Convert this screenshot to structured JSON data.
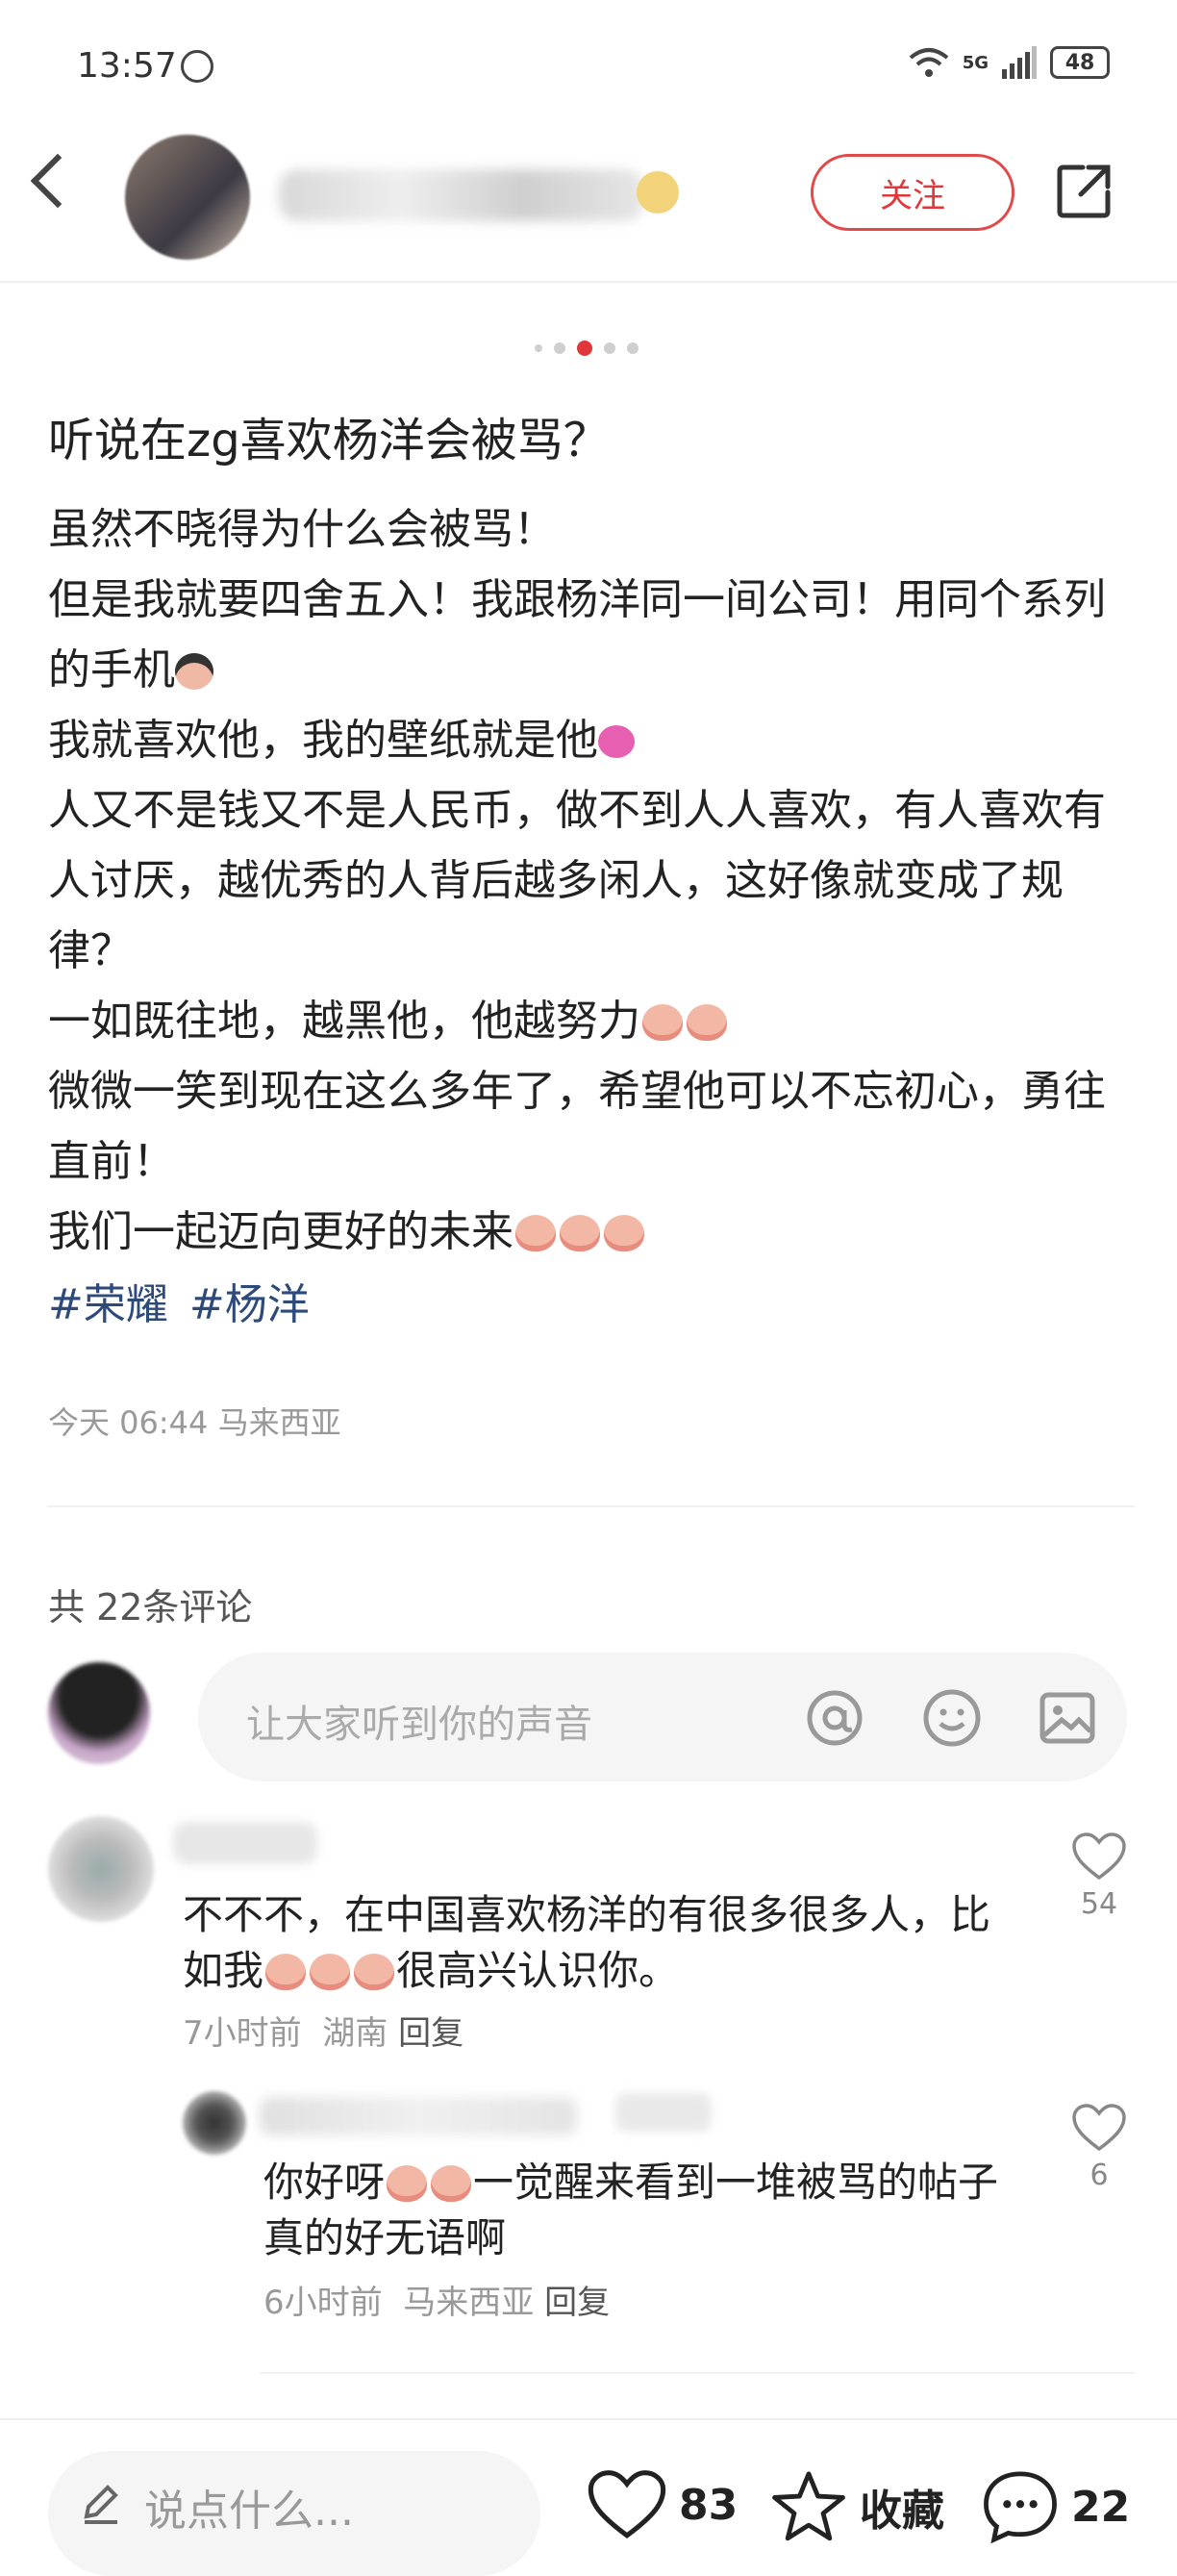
{
  "status_bar": {
    "time": "13:57",
    "network": "5G",
    "battery": "48"
  },
  "header": {
    "follow_label": "关注"
  },
  "carousel": {
    "total": 5,
    "active": 3
  },
  "post": {
    "title": "听说在zg喜欢杨洋会被骂？",
    "lines": [
      "虽然不晓得为什么会被骂！",
      "但是我就要四舍五入！我跟杨洋同一间公司！用同个系列的手机",
      "我就喜欢他，我的壁纸就是他",
      "人又不是钱又不是人民币，做不到人人喜欢，有人喜欢有人讨厌，越优秀的人背后越多闲人，这好像就变成了规律？",
      "一如既往地，越黑他，他越努力",
      "微微一笑到现在这么多年了，希望他可以不忘初心，勇往直前！",
      "我们一起迈向更好的未来"
    ],
    "tags": [
      "#荣耀",
      "#杨洋"
    ],
    "meta": "今天 06:44 马来西亚"
  },
  "comments": {
    "count_label": "共 22条评论",
    "input_placeholder": "让大家听到你的声音",
    "items": [
      {
        "text_a": "不不不，在中国喜欢杨洋的有很多很多人，比如我",
        "text_b": "很高兴认识你。",
        "time": "7小时前",
        "location": "湖南",
        "reply": "回复",
        "likes": "54"
      },
      {
        "text_a": "你好呀",
        "text_b": "一觉醒来看到一堆被骂的帖子真的好无语啊",
        "time": "6小时前",
        "location": "马来西亚",
        "reply": "回复",
        "likes": "6"
      }
    ]
  },
  "bottom_bar": {
    "input_placeholder": "说点什么...",
    "likes": "83",
    "favorite_label": "收藏",
    "comments": "22"
  },
  "colors": {
    "accent": "#e0373a",
    "tag": "#2d4a7a",
    "muted": "#999999"
  }
}
